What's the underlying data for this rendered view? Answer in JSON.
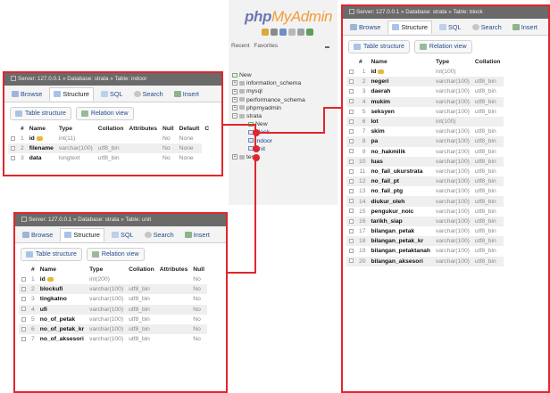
{
  "nav": {
    "logo_php": "php",
    "logo_rest": "MyAdmin",
    "links": [
      "Recent",
      "Favorites"
    ],
    "tree": [
      {
        "label": "New",
        "kind": "new",
        "indent": 0
      },
      {
        "label": "information_schema",
        "kind": "db",
        "indent": 0
      },
      {
        "label": "mysql",
        "kind": "db",
        "indent": 0
      },
      {
        "label": "performance_schema",
        "kind": "db",
        "indent": 0
      },
      {
        "label": "phpmyadmin",
        "kind": "db",
        "indent": 0
      },
      {
        "label": "strata",
        "kind": "db",
        "indent": 0,
        "open": true
      },
      {
        "label": "New",
        "kind": "new",
        "indent": 1
      },
      {
        "label": "block",
        "kind": "table",
        "indent": 1
      },
      {
        "label": "indoor",
        "kind": "table",
        "indent": 1
      },
      {
        "label": "unit",
        "kind": "table",
        "indent": 1
      },
      {
        "label": "test",
        "kind": "db",
        "indent": 0
      }
    ]
  },
  "tabs": {
    "browse": "Browse",
    "structure": "Structure",
    "sql": "SQL",
    "search": "Search",
    "insert": "Insert"
  },
  "subtabs": {
    "table_structure": "Table structure",
    "relation_view": "Relation view"
  },
  "panels": {
    "indoor": {
      "title": "Server: 127.0.0.1 » Database: strata » Table: indoor",
      "headers": [
        "#",
        "Name",
        "Type",
        "Collation",
        "Attributes",
        "Null",
        "Default",
        "C"
      ],
      "rows": [
        {
          "n": "1",
          "name": "id",
          "key": true,
          "type": "int(11)",
          "coll": "",
          "attr": "",
          "null": "No",
          "def": "None"
        },
        {
          "n": "2",
          "name": "filename",
          "key": false,
          "type": "varchar(100)",
          "coll": "utf8_bin",
          "attr": "",
          "null": "No",
          "def": "None"
        },
        {
          "n": "3",
          "name": "data",
          "key": false,
          "type": "longtext",
          "coll": "utf8_bin",
          "attr": "",
          "null": "No",
          "def": "None"
        }
      ]
    },
    "unit": {
      "title": "Server: 127.0.0.1 » Database: strata » Table: unit",
      "headers": [
        "#",
        "Name",
        "Type",
        "Collation",
        "Attributes",
        "Null"
      ],
      "rows": [
        {
          "n": "1",
          "name": "id",
          "key": true,
          "type": "int(200)",
          "coll": "",
          "attr": "",
          "null": "No"
        },
        {
          "n": "2",
          "name": "blockufi",
          "key": false,
          "type": "varchar(100)",
          "coll": "utf8_bin",
          "attr": "",
          "null": "No"
        },
        {
          "n": "3",
          "name": "tingkatno",
          "key": false,
          "type": "varchar(100)",
          "coll": "utf8_bin",
          "attr": "",
          "null": "No"
        },
        {
          "n": "4",
          "name": "ufi",
          "key": false,
          "type": "varchar(100)",
          "coll": "utf8_bin",
          "attr": "",
          "null": "No"
        },
        {
          "n": "5",
          "name": "no_of_petak",
          "key": false,
          "type": "varchar(100)",
          "coll": "utf8_bin",
          "attr": "",
          "null": "No"
        },
        {
          "n": "6",
          "name": "no_of_petak_kr",
          "key": false,
          "type": "varchar(100)",
          "coll": "utf8_bin",
          "attr": "",
          "null": "No"
        },
        {
          "n": "7",
          "name": "no_of_aksesori",
          "key": false,
          "type": "varchar(100)",
          "coll": "utf8_bin",
          "attr": "",
          "null": "No"
        }
      ]
    },
    "block": {
      "title": "Server: 127.0.0.1 » Database: strata » Table: block",
      "headers": [
        "#",
        "Name",
        "Type",
        "Collation"
      ],
      "rows": [
        {
          "n": "1",
          "name": "id",
          "key": true,
          "type": "int(100)",
          "coll": ""
        },
        {
          "n": "2",
          "name": "negeri",
          "key": false,
          "type": "varchar(100)",
          "coll": "utf8_bin"
        },
        {
          "n": "3",
          "name": "daerah",
          "key": false,
          "type": "varchar(100)",
          "coll": "utf8_bin"
        },
        {
          "n": "4",
          "name": "mukim",
          "key": false,
          "type": "varchar(100)",
          "coll": "utf8_bin"
        },
        {
          "n": "5",
          "name": "seksyen",
          "key": false,
          "type": "varchar(100)",
          "coll": "utf8_bin"
        },
        {
          "n": "6",
          "name": "lot",
          "key": false,
          "type": "int(100)",
          "coll": ""
        },
        {
          "n": "7",
          "name": "skim",
          "key": false,
          "type": "varchar(100)",
          "coll": "utf8_bin"
        },
        {
          "n": "8",
          "name": "pa",
          "key": false,
          "type": "varchar(100)",
          "coll": "utf8_bin"
        },
        {
          "n": "9",
          "name": "no_hakmilik",
          "key": false,
          "type": "varchar(100)",
          "coll": "utf8_bin"
        },
        {
          "n": "10",
          "name": "luas",
          "key": false,
          "type": "varchar(100)",
          "coll": "utf8_bin"
        },
        {
          "n": "11",
          "name": "no_fail_ukurstrata",
          "key": false,
          "type": "varchar(100)",
          "coll": "utf8_bin"
        },
        {
          "n": "12",
          "name": "no_fail_pt",
          "key": false,
          "type": "varchar(100)",
          "coll": "utf8_bin"
        },
        {
          "n": "13",
          "name": "no_fail_ptg",
          "key": false,
          "type": "varchar(100)",
          "coll": "utf8_bin"
        },
        {
          "n": "14",
          "name": "diukur_oleh",
          "key": false,
          "type": "varchar(100)",
          "coll": "utf8_bin"
        },
        {
          "n": "15",
          "name": "pengukur_noic",
          "key": false,
          "type": "varchar(100)",
          "coll": "utf8_bin"
        },
        {
          "n": "16",
          "name": "tarikh_siap",
          "key": false,
          "type": "varchar(100)",
          "coll": "utf8_bin"
        },
        {
          "n": "17",
          "name": "bilangan_petak",
          "key": false,
          "type": "varchar(100)",
          "coll": "utf8_bin"
        },
        {
          "n": "18",
          "name": "bilangan_petak_kr",
          "key": false,
          "type": "varchar(100)",
          "coll": "utf8_bin"
        },
        {
          "n": "19",
          "name": "bilangan_petaktanah",
          "key": false,
          "type": "varchar(100)",
          "coll": "utf8_bin"
        },
        {
          "n": "20",
          "name": "bilangan_aksesori",
          "key": false,
          "type": "varchar(100)",
          "coll": "utf8_bin"
        }
      ]
    }
  },
  "colors": {
    "accent_red": "#e0262c",
    "title_bar": "#6a6a6a",
    "link_blue": "#234c8c"
  }
}
